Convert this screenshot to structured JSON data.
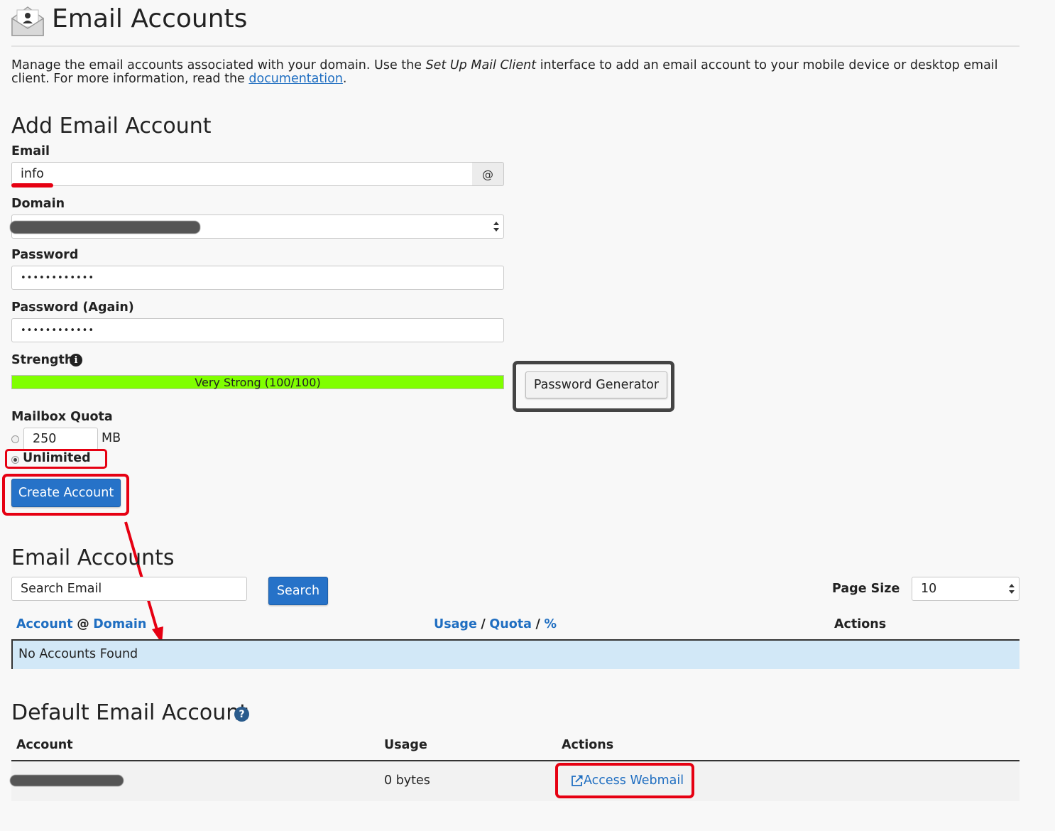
{
  "header": {
    "title": "Email Accounts"
  },
  "intro": {
    "text_before": "Manage the email accounts associated with your domain. Use the ",
    "emphasis": "Set Up Mail Client",
    "text_after": " interface to add an email account to your mobile device or desktop email client. For more information, read the ",
    "link": "documentation",
    "text_end": "."
  },
  "add_account": {
    "heading": "Add Email Account",
    "email_label": "Email",
    "email_value": "info",
    "at_symbol": "@",
    "domain_label": "Domain",
    "password_label": "Password",
    "password_value": "••••••••••••",
    "password_again_label": "Password (Again)",
    "password_again_value": "••••••••••••",
    "strength_label": "Strength",
    "strength_text": "Very Strong (100/100)",
    "strength_value": 100,
    "strength_color": "#80ff00",
    "password_generator": "Password Generator",
    "quota_label": "Mailbox Quota",
    "quota_value": "250",
    "quota_unit": "MB",
    "unlimited_label": "Unlimited",
    "create_button": "Create Account"
  },
  "accounts_list": {
    "heading": "Email Accounts",
    "search_placeholder": "Search Email",
    "search_button": "Search",
    "page_size_label": "Page Size",
    "page_size_value": "10",
    "col_account": "Account",
    "col_at": "@",
    "col_domain": "Domain",
    "col_usage": "Usage",
    "col_slash1": "/",
    "col_quota": "Quota",
    "col_slash2": "/",
    "col_percent": "%",
    "col_actions": "Actions",
    "empty_message": "No Accounts Found",
    "row_highlight_color": "#d2e8f7"
  },
  "default_account": {
    "heading": "Default Email Account",
    "col_account": "Account",
    "col_usage": "Usage",
    "col_actions": "Actions",
    "usage_value": "0 bytes",
    "webmail_link": "Access Webmail"
  },
  "colors": {
    "accent_blue": "#2672c8",
    "link_blue": "#1f6ec1",
    "annotation_red": "#e60012"
  }
}
